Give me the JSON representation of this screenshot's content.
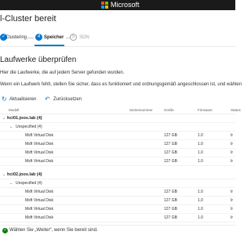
{
  "header": {
    "brand": "Microsoft"
  },
  "page": {
    "title": "l-Cluster bereit"
  },
  "steps": [
    {
      "marker": "✓",
      "label": "Clustering",
      "state": "done"
    },
    {
      "marker": "4",
      "label": "Speicher",
      "state": "active"
    },
    {
      "marker": "5",
      "label": "SDN",
      "state": "disabled"
    }
  ],
  "section": {
    "heading": "Laufwerke überprüfen",
    "description": "Hier die Laufwerke, die auf jedem Server gefunden wurden.",
    "hint": "Wenn ein Laufwerk fehlt, stellen Sie sicher, dass es funktioniert und ordnungsgemäß angeschlossen ist, und wählen"
  },
  "toolbar": {
    "refresh_label": "Aktualisieren",
    "reset_label": "Zurücksetzen"
  },
  "table": {
    "columns": {
      "model": "Modell",
      "serial": "Seriennummer",
      "size": "Größe",
      "firmware": "Firmware",
      "status": "Status"
    },
    "servers": [
      {
        "name": "hci01.joos.lab (4)",
        "group": "Unspecified (4)",
        "disks": [
          {
            "model": "Msft Virtual Disk",
            "size": "127 GB",
            "firmware": "1.0",
            "status": "Ir"
          },
          {
            "model": "Msft Virtual Disk",
            "size": "127 GB",
            "firmware": "1.0",
            "status": "Ir"
          },
          {
            "model": "Msft Virtual Disk",
            "size": "127 GB",
            "firmware": "1.0",
            "status": "Ir"
          },
          {
            "model": "Msft Virtual Disk",
            "size": "127 GB",
            "firmware": "1.0",
            "status": "Ir"
          }
        ]
      },
      {
        "name": "hci02.joos.lab (4)",
        "group": "Unspecified (4)",
        "disks": [
          {
            "model": "Msft Virtual Disk",
            "size": "127 GB",
            "firmware": "1.0",
            "status": "Ir"
          },
          {
            "model": "Msft Virtual Disk",
            "size": "127 GB",
            "firmware": "1.0",
            "status": "Ir"
          },
          {
            "model": "Msft Virtual Disk",
            "size": "127 GB",
            "firmware": "1.0",
            "status": "Ir"
          },
          {
            "model": "Msft Virtual Disk",
            "size": "127 GB",
            "firmware": "1.0",
            "status": "Ir"
          }
        ]
      }
    ]
  },
  "status_bar": {
    "icon": "check-circle-icon",
    "text": "Wählen Sie „Weiter“, wenn Sie bereit sind."
  },
  "colors": {
    "accent": "#0078d4",
    "success": "#107c10",
    "topbar": "#1a1a1a"
  }
}
